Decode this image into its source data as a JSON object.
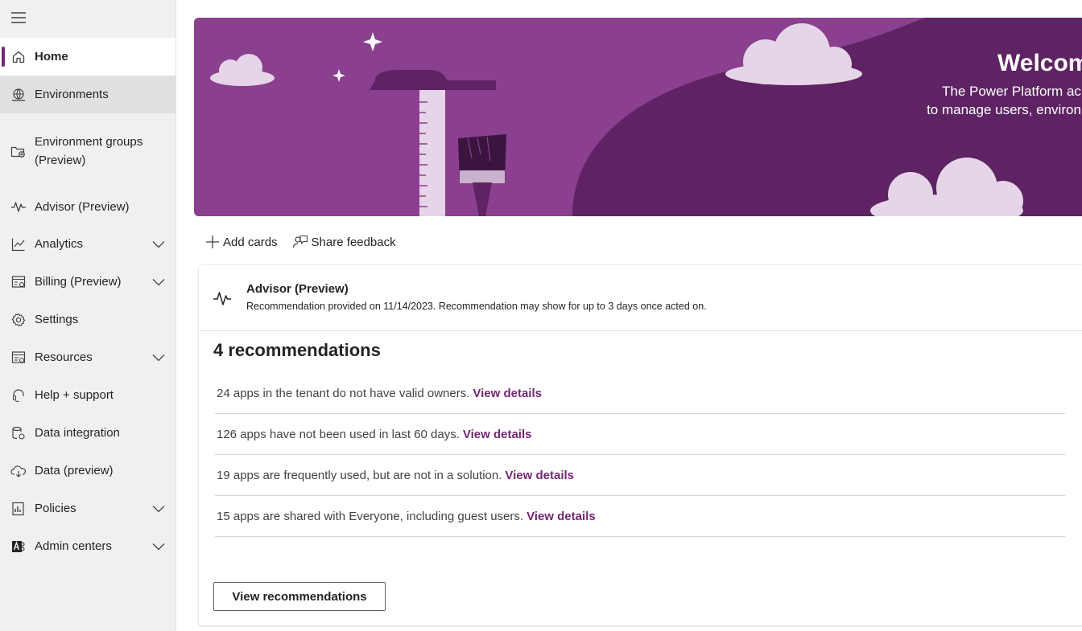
{
  "sidebar": {
    "items": [
      {
        "label": "Home",
        "icon": "home-icon"
      },
      {
        "label": "Environments",
        "icon": "globe-icon"
      },
      {
        "label": "Environment groups (Preview)",
        "icon": "folder-globe-icon"
      },
      {
        "label": "Advisor (Preview)",
        "icon": "pulse-icon"
      },
      {
        "label": "Analytics",
        "icon": "line-chart-icon"
      },
      {
        "label": "Billing (Preview)",
        "icon": "billing-icon"
      },
      {
        "label": "Settings",
        "icon": "gear-icon"
      },
      {
        "label": "Resources",
        "icon": "resources-icon"
      },
      {
        "label": "Help + support",
        "icon": "headset-icon"
      },
      {
        "label": "Data integration",
        "icon": "data-integration-icon"
      },
      {
        "label": "Data (preview)",
        "icon": "cloud-data-icon"
      },
      {
        "label": "Policies",
        "icon": "policies-icon"
      },
      {
        "label": "Admin centers",
        "icon": "admin-centers-icon"
      }
    ]
  },
  "banner": {
    "title": "Welcom",
    "subtitle_line1": "The Power Platform ac",
    "subtitle_line2": "to manage users, environ"
  },
  "toolbar": {
    "add_cards": "Add cards",
    "share_feedback": "Share feedback"
  },
  "card": {
    "title": "Advisor (Preview)",
    "subtitle": "Recommendation provided on 11/14/2023. Recommendation may show for up to 3 days once acted on.",
    "count_label": "4 recommendations",
    "recommendations": [
      {
        "text": "24 apps in the tenant do not have valid owners.",
        "link": "View details"
      },
      {
        "text": "126 apps have not been used in last 60 days.",
        "link": "View details"
      },
      {
        "text": "19 apps are frequently used, but are not in a solution.",
        "link": "View details"
      },
      {
        "text": "15 apps are shared with Everyone, including guest users.",
        "link": "View details"
      }
    ],
    "button_label": "View recommendations"
  },
  "colors": {
    "accent": "#742774",
    "banner_light": "#8b3f8f",
    "banner_dark": "#5e2363"
  }
}
